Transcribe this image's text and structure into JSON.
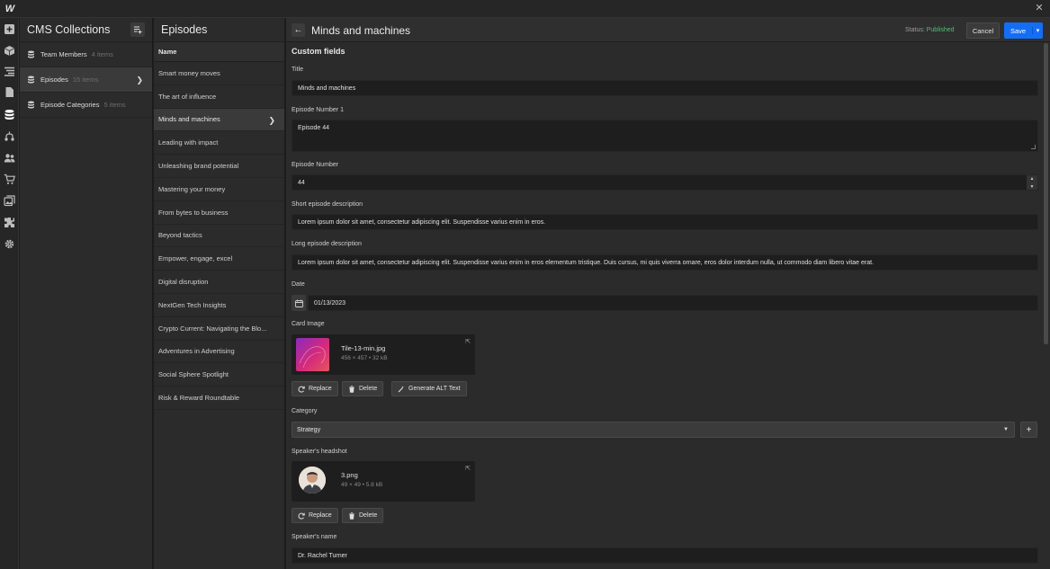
{
  "app": {
    "logo": "W",
    "close_label": "✕"
  },
  "rail": {
    "icons": [
      "add-icon",
      "box-icon",
      "navigator-icon",
      "pages-icon",
      "cms-icon",
      "logic-icon",
      "users-icon",
      "ecommerce-icon",
      "assets-icon",
      "apps-icon",
      "settings-icon"
    ]
  },
  "collections": {
    "title": "CMS Collections",
    "items": [
      {
        "name": "Team Members",
        "count": "4 items"
      },
      {
        "name": "Episodes",
        "count": "15 items"
      },
      {
        "name": "Episode Categories",
        "count": "5 items"
      }
    ]
  },
  "episodes": {
    "title": "Episodes",
    "column_header": "Name",
    "items": [
      "Smart money moves",
      "The art of influence",
      "Minds and machines",
      "Leading with impact",
      "Unleashing brand potential",
      "Mastering your money",
      "From bytes to business",
      "Beyond tactics",
      "Empower, engage, excel",
      "Digital disruption",
      "NextGen Tech Insights",
      "Crypto Current: Navigating the Blo...",
      "Adventures in Advertising",
      "Social Sphere Spotlight",
      "Risk & Reward Roundtable"
    ]
  },
  "editor": {
    "title": "Minds and machines",
    "status_label": "Status:",
    "status_value": "Published",
    "cancel_label": "Cancel",
    "save_label": "Save",
    "section_title": "Custom fields",
    "fields": {
      "title": {
        "label": "Title",
        "value": "Minds and machines"
      },
      "episode_number_1": {
        "label": "Episode Number 1",
        "value": "Episode 44"
      },
      "episode_number": {
        "label": "Episode Number",
        "value": "44"
      },
      "short_desc": {
        "label": "Short episode description",
        "value": "Lorem ipsum dolor sit amet, consectetur adipiscing elit. Suspendisse varius enim in eros."
      },
      "long_desc": {
        "label": "Long episode description",
        "value": "Lorem ipsum dolor sit amet, consectetur adipiscing elit. Suspendisse varius enim in eros elementum tristique. Duis cursus, mi quis viverra ornare, eros dolor interdum nulla, ut commodo diam libero vitae erat."
      },
      "date": {
        "label": "Date",
        "value": "01/13/2023"
      },
      "card_image": {
        "label": "Card Image",
        "file_name": "Tile-13-min.jpg",
        "file_meta": "456 × 457 • 32 kB",
        "replace_label": "Replace",
        "delete_label": "Delete",
        "alt_label": "Generate ALT Text"
      },
      "category": {
        "label": "Category",
        "value": "Strategy"
      },
      "headshot": {
        "label": "Speaker's headshot",
        "file_name": "3.png",
        "file_meta": "49 × 49 • 5.8 kB",
        "replace_label": "Replace",
        "delete_label": "Delete"
      },
      "speaker_name": {
        "label": "Speaker's name",
        "value": "Dr. Rachel Turner"
      }
    }
  },
  "colors": {
    "accent": "#146ef5",
    "published": "#4fbf7a",
    "panel": "#2b2b2b",
    "input": "#1e1e1e"
  }
}
